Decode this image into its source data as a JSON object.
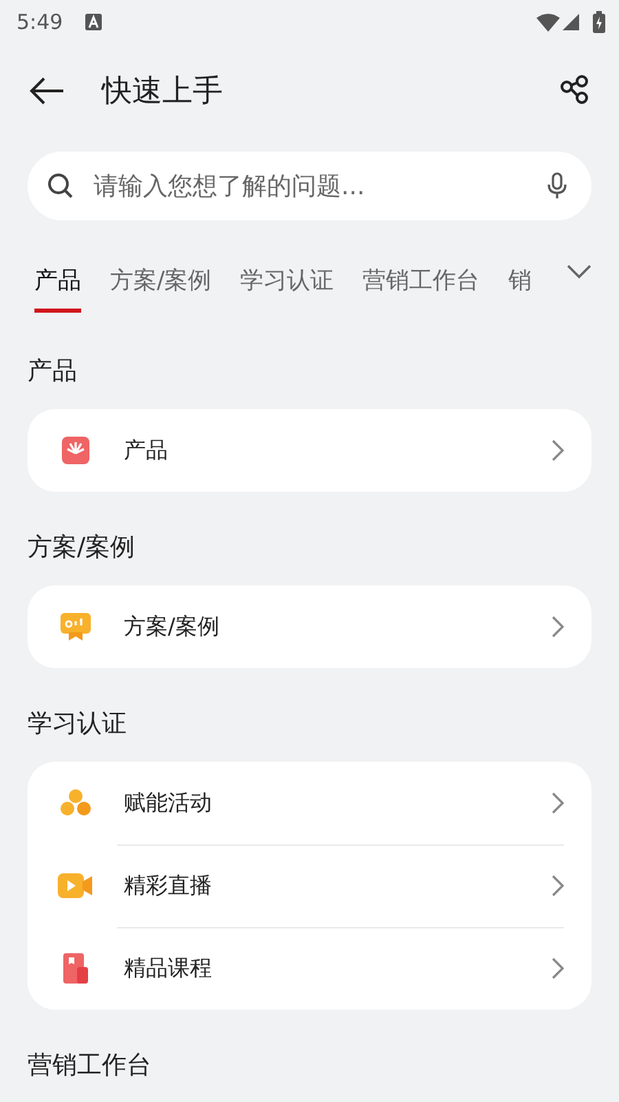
{
  "status_bar": {
    "time": "5:49"
  },
  "header": {
    "title": "快速上手"
  },
  "search": {
    "placeholder": "请输入您想了解的问题..."
  },
  "tabs": [
    {
      "label": "产品",
      "selected": true
    },
    {
      "label": "方案/案例",
      "selected": false
    },
    {
      "label": "学习认证",
      "selected": false
    },
    {
      "label": "营销工作台",
      "selected": false
    },
    {
      "label": "销",
      "selected": false
    }
  ],
  "sections": [
    {
      "title": "产品",
      "items": [
        {
          "label": "产品",
          "kind": "product"
        }
      ]
    },
    {
      "title": "方案/案例",
      "items": [
        {
          "label": "方案/案例",
          "kind": "case"
        }
      ]
    },
    {
      "title": "学习认证",
      "items": [
        {
          "label": "赋能活动",
          "kind": "activity"
        },
        {
          "label": "精彩直播",
          "kind": "live"
        },
        {
          "label": "精品课程",
          "kind": "course"
        }
      ]
    },
    {
      "title": "营销工作台"
    }
  ]
}
